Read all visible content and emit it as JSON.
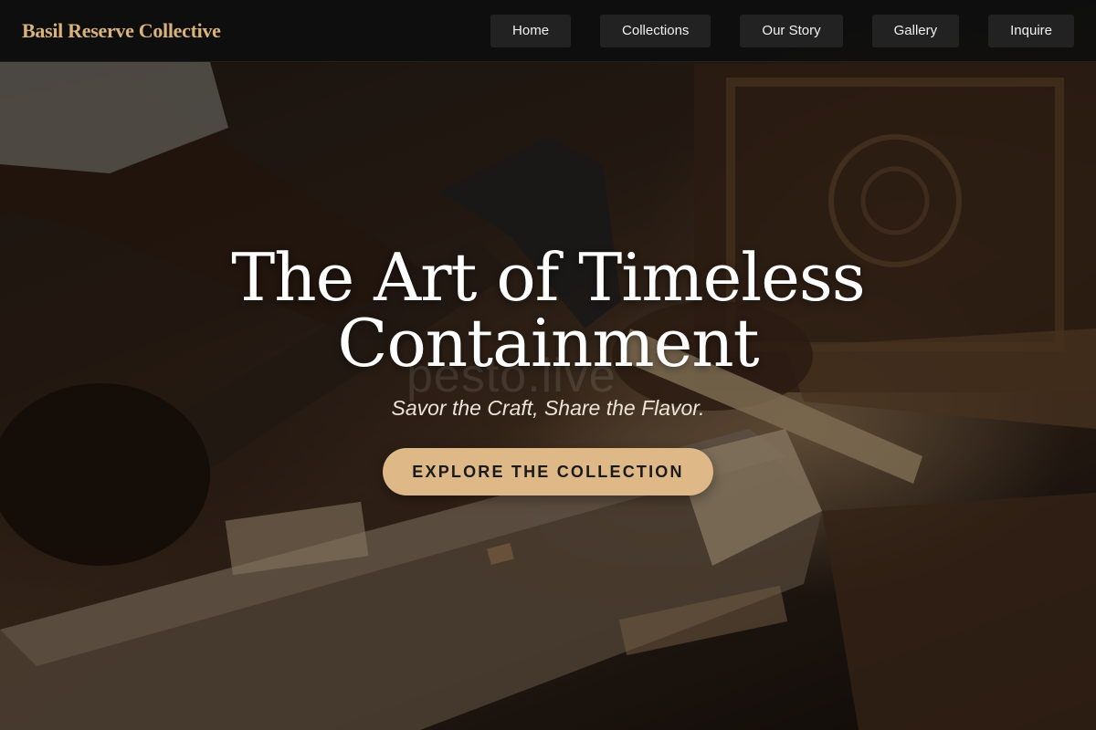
{
  "nav": {
    "brand": "Basil Reserve Collective",
    "links": [
      {
        "label": "Home"
      },
      {
        "label": "Collections"
      },
      {
        "label": "Our Story"
      },
      {
        "label": "Gallery"
      },
      {
        "label": "Inquire"
      }
    ]
  },
  "hero": {
    "title": "The Art of Timeless Containment",
    "tagline": "Savor the Craft, Share the Flavor.",
    "cta_label": "EXPLORE THE COLLECTION",
    "image_alt": "Woodworker carving a wooden piece with a chisel and mallet"
  },
  "watermark": "pesto.live",
  "colors": {
    "brand": "#d9b27c",
    "cta_bg": "#dfb888",
    "nav_bg": "#0e0e0e",
    "nav_button_bg": "#222222"
  }
}
